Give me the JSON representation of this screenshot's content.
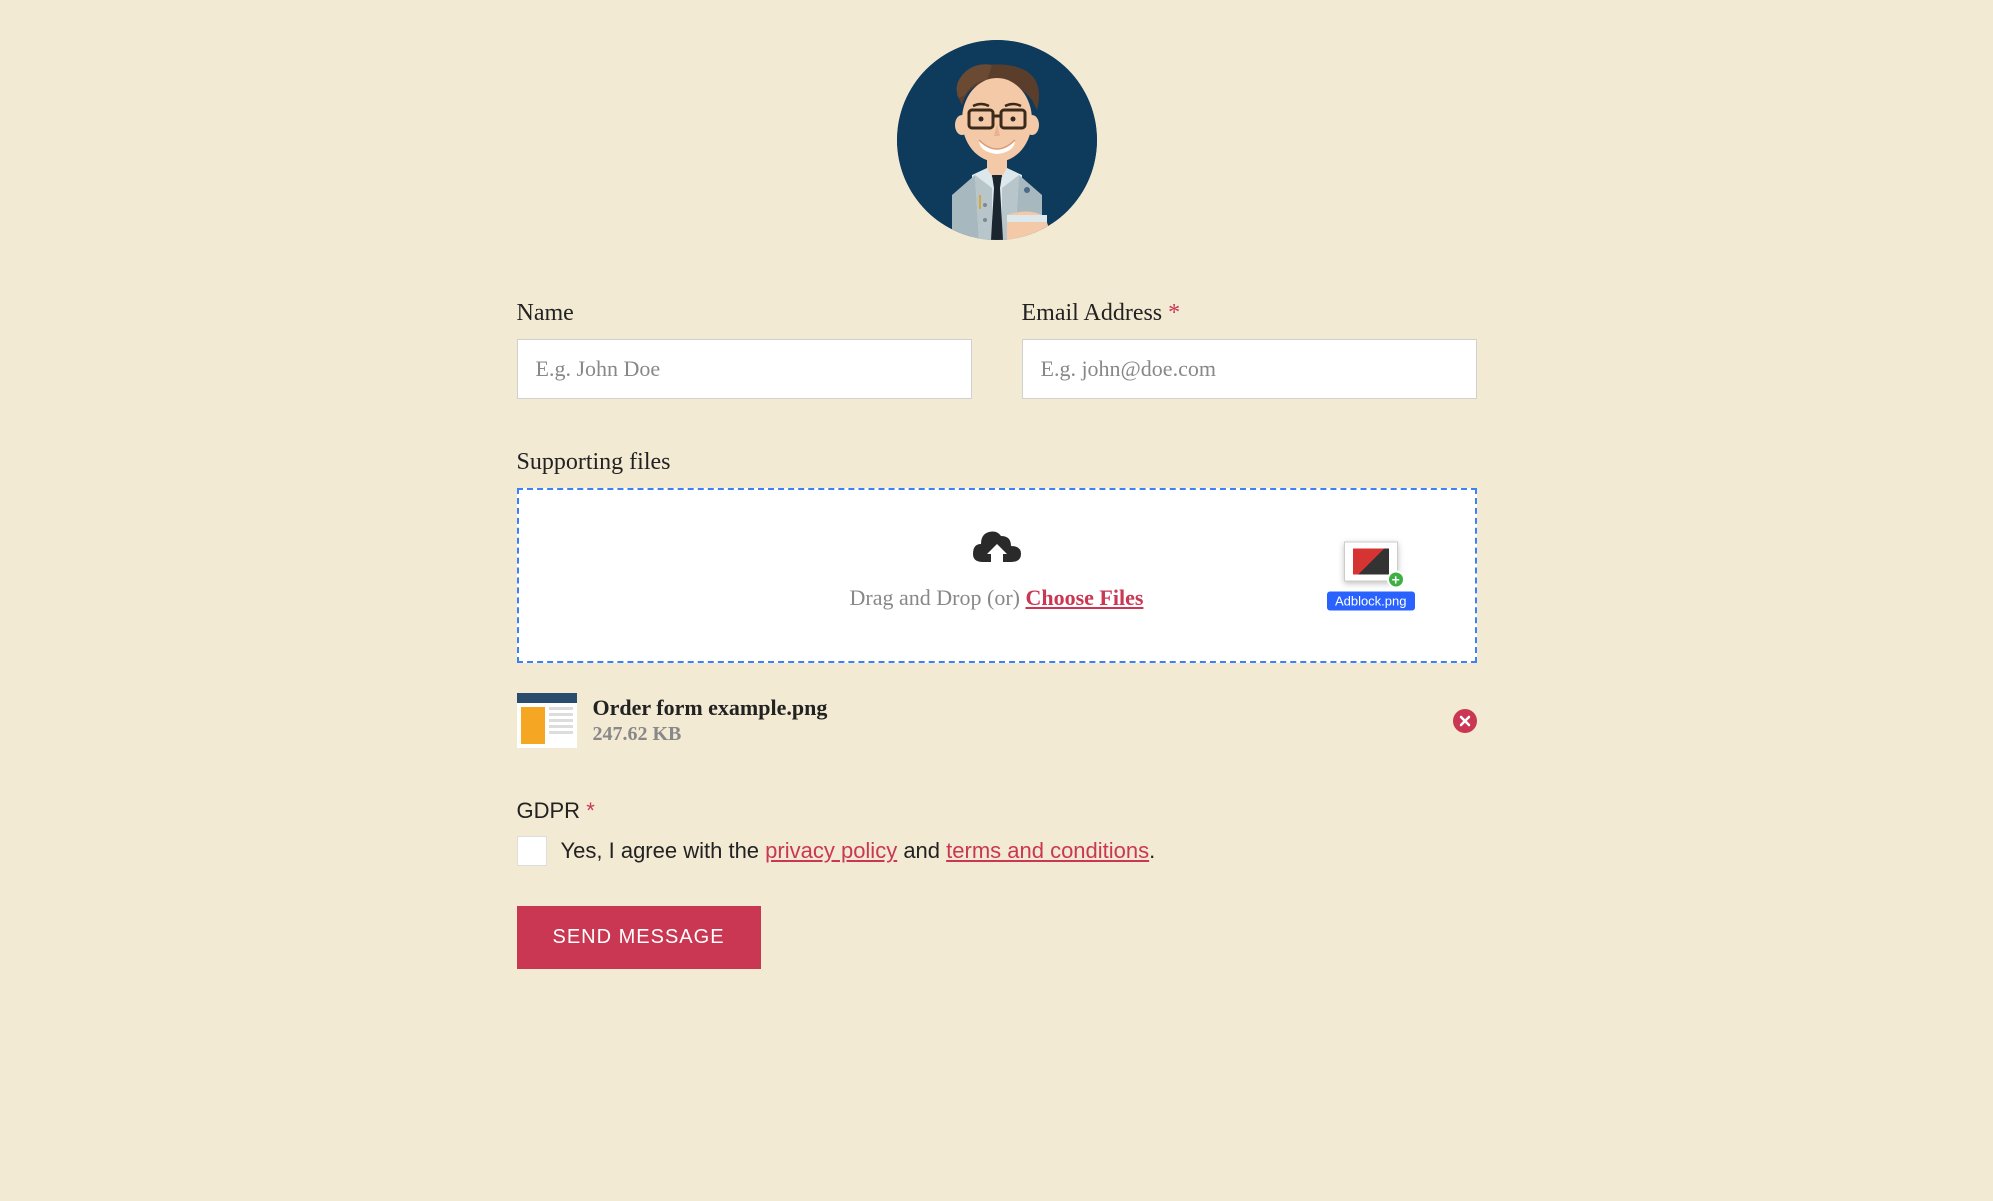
{
  "form": {
    "name_label": "Name",
    "name_placeholder": "E.g. John Doe",
    "email_label": "Email Address",
    "email_placeholder": "E.g. john@doe.com",
    "required_mark": "*"
  },
  "upload": {
    "label": "Supporting files",
    "drag_text": "Drag and Drop (or) ",
    "choose_link": "Choose Files",
    "dragging_filename": "Adblock.png"
  },
  "uploaded_file": {
    "name": "Order form example.png",
    "size": "247.62 KB"
  },
  "gdpr": {
    "label": "GDPR",
    "required_mark": "*",
    "text_prefix": "Yes, I agree with the ",
    "privacy_link": "privacy policy",
    "text_mid": " and ",
    "terms_link": "terms and conditions",
    "text_suffix": "."
  },
  "submit": {
    "label": "SEND MESSAGE"
  }
}
